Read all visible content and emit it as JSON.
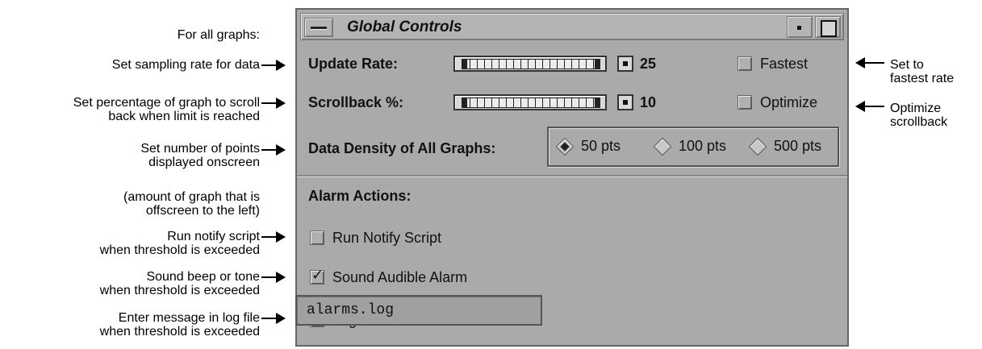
{
  "annotations_left": [
    {
      "id": "for_all",
      "text": "For all graphs:"
    },
    {
      "id": "sampling",
      "text": "Set sampling rate for data"
    },
    {
      "id": "scroll",
      "lines": [
        "Set percentage of graph to scroll",
        "back when limit is reached"
      ]
    },
    {
      "id": "points",
      "lines": [
        "Set number of points",
        "displayed onscreen"
      ]
    },
    {
      "id": "amount",
      "lines": [
        "(amount of graph that is",
        "offscreen to the left)"
      ]
    },
    {
      "id": "notify",
      "lines": [
        "Run notify script",
        "when threshold is exceeded"
      ]
    },
    {
      "id": "beep",
      "lines": [
        "Sound beep or tone",
        "when threshold is exceeded"
      ]
    },
    {
      "id": "log",
      "lines": [
        "Enter message in log file",
        "when threshold is exceeded"
      ]
    }
  ],
  "annotations_right": [
    {
      "id": "fastest",
      "lines": [
        "Set to",
        "fastest rate"
      ]
    },
    {
      "id": "optimize",
      "lines": [
        "Optimize",
        "scrollback"
      ]
    }
  ],
  "window": {
    "title": "Global Controls",
    "update_rate": {
      "label": "Update Rate:",
      "value": "25",
      "checkbox_label": "Fastest",
      "checked": false
    },
    "scrollback": {
      "label": "Scrollback %:",
      "value": "10",
      "checkbox_label": "Optimize",
      "checked": false
    },
    "density": {
      "label": "Data Density of All Graphs:",
      "options": [
        {
          "label": "50 pts",
          "selected": true
        },
        {
          "label": "100 pts",
          "selected": false
        },
        {
          "label": "500 pts",
          "selected": false
        }
      ]
    },
    "alarm": {
      "heading": "Alarm Actions:",
      "run_notify": {
        "label": "Run Notify Script",
        "checked": false
      },
      "sound": {
        "label": "Sound Audible Alarm",
        "checked": true
      },
      "log": {
        "label": "Log to File:",
        "checked": true,
        "value": "alarms.log"
      }
    }
  }
}
